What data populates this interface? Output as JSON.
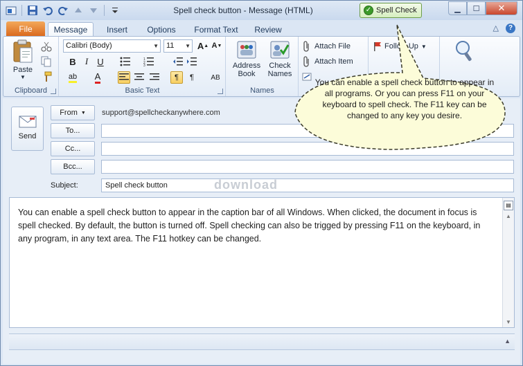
{
  "window": {
    "title": "Spell check button  -  Message (HTML)",
    "spell_check_button": "Spell Check"
  },
  "tabs": [
    {
      "label": "File"
    },
    {
      "label": "Message"
    },
    {
      "label": "Insert"
    },
    {
      "label": "Options"
    },
    {
      "label": "Format Text"
    },
    {
      "label": "Review"
    }
  ],
  "ribbon": {
    "clipboard": {
      "paste": "Paste",
      "label": "Clipboard"
    },
    "basic_text": {
      "font": "Calibri (Body)",
      "size": "11",
      "label": "Basic Text"
    },
    "names": {
      "address_book_1": "Address",
      "address_book_2": "Book",
      "check_names_1": "Check",
      "check_names_2": "Names",
      "label": "Names"
    },
    "include": {
      "attach_file": "Attach File",
      "attach_item": "Attach Item"
    },
    "tags": {
      "follow_up": "Follow Up"
    }
  },
  "compose": {
    "send": "Send",
    "from_label": "From",
    "from_address": "support@spellcheckanywhere.com",
    "to_label": "To...",
    "cc_label": "Cc...",
    "bcc_label": "Bcc...",
    "subject_label": "Subject:",
    "subject_value": "Spell check button",
    "body": "You can enable a spell check button to appear in the caption bar of all Windows.  When clicked, the document in focus is spell checked.  By default, the button is turned off.  Spell checking can also be trigged by pressing F11 on the keyboard, in any program, in any text area.  The F11 hotkey can be changed."
  },
  "watermark": "download",
  "callout": {
    "text": "You can enable a spell check button to appear in all programs.  Or you can press F11 on your keyboard to spell check.  The F11 key can be changed to any key you desire."
  }
}
